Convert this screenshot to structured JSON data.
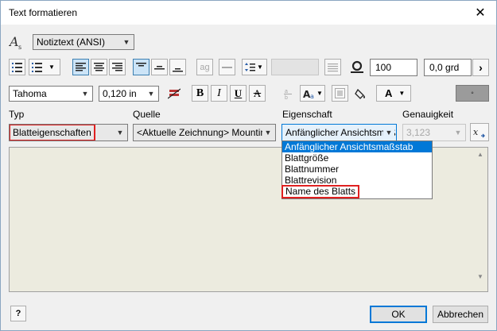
{
  "window": {
    "title": "Text formatieren",
    "close_glyph": "✕"
  },
  "toolbar1": {
    "style_value": "Notiztext (ANSI)"
  },
  "toolbar2": {
    "spacing_value": "100",
    "rotation_value": "0,0 grd",
    "next_glyph": "›",
    "ag_label": "ag"
  },
  "toolbar3": {
    "font_value": "Tahoma",
    "size_value": "0,120 in",
    "bold": "B",
    "italic": "I",
    "underline": "U",
    "strike": "A",
    "textcolor": "A",
    "bgcolor_dot": "◦"
  },
  "labels": {
    "typ": "Typ",
    "quelle": "Quelle",
    "eigenschaft": "Eigenschaft",
    "genauigkeit": "Genauigkeit"
  },
  "selects": {
    "typ": "Blatteigenschaften",
    "quelle": "<Aktuelle Zeichnung> Mounting",
    "eigenschaft": "Anfänglicher Ansichtsmaßstab",
    "genauigkeit": "3,123"
  },
  "dropdown_items": [
    "Anfänglicher Ansichtsmaßstab",
    "Blattgröße",
    "Blattnummer",
    "Blattrevision",
    "Name des Blatts"
  ],
  "buttons": {
    "ok": "OK",
    "cancel": "Abbrechen",
    "help": "?"
  }
}
